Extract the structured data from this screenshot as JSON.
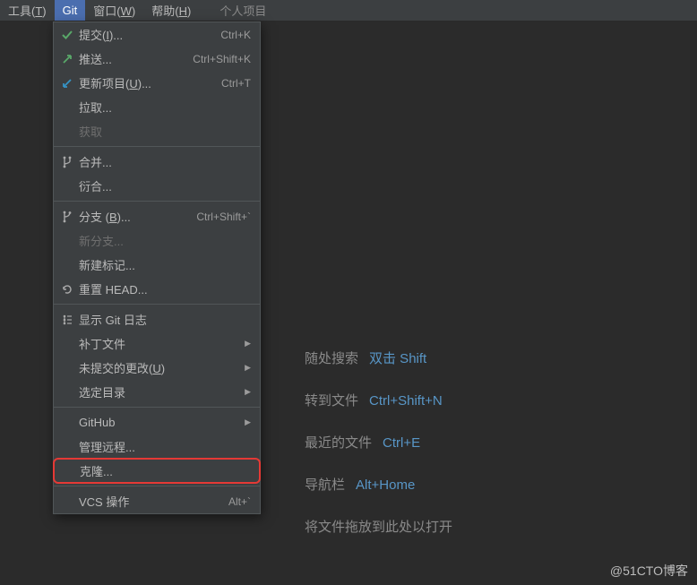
{
  "menubar": {
    "items": [
      {
        "label": "工具(T)",
        "underline": "T"
      },
      {
        "label": "Git"
      },
      {
        "label": "窗口(W)",
        "underline": "W"
      },
      {
        "label": "帮助(H)",
        "underline": "H"
      }
    ],
    "project": "个人项目"
  },
  "dropdown": {
    "groups": [
      [
        {
          "icon": "check-icon",
          "label": "提交(I)...",
          "shortcut": "Ctrl+K"
        },
        {
          "icon": "push-icon",
          "label": "推送...",
          "shortcut": "Ctrl+Shift+K"
        },
        {
          "icon": "update-icon",
          "label": "更新项目(U)...",
          "shortcut": "Ctrl+T"
        },
        {
          "label": "拉取..."
        },
        {
          "label": "获取",
          "disabled": true
        }
      ],
      [
        {
          "icon": "merge-icon",
          "label": "合并..."
        },
        {
          "label": "衍合..."
        }
      ],
      [
        {
          "icon": "branch-icon",
          "label": "分支 (B)...",
          "shortcut": "Ctrl+Shift+`"
        },
        {
          "label": "新分支...",
          "disabled": true
        },
        {
          "label": "新建标记..."
        },
        {
          "icon": "reset-icon",
          "label": "重置 HEAD..."
        }
      ],
      [
        {
          "icon": "log-icon",
          "label": "显示 Git 日志"
        },
        {
          "label": "补丁文件",
          "submenu": true
        },
        {
          "label": "未提交的更改(U)",
          "submenu": true
        },
        {
          "label": "选定目录",
          "submenu": true
        }
      ],
      [
        {
          "label": "GitHub",
          "submenu": true
        },
        {
          "label": "管理远程..."
        },
        {
          "label": "克隆...",
          "highlight": true
        }
      ],
      [
        {
          "label": "VCS 操作",
          "shortcut": "Alt+`"
        }
      ]
    ]
  },
  "welcome": {
    "rows": [
      {
        "label": "随处搜索",
        "key": "双击 Shift"
      },
      {
        "label": "转到文件",
        "key": "Ctrl+Shift+N"
      },
      {
        "label": "最近的文件",
        "key": "Ctrl+E"
      },
      {
        "label": "导航栏",
        "key": "Alt+Home"
      }
    ],
    "drag": "将文件拖放到此处以打开"
  },
  "watermark": "@51CTO博客"
}
